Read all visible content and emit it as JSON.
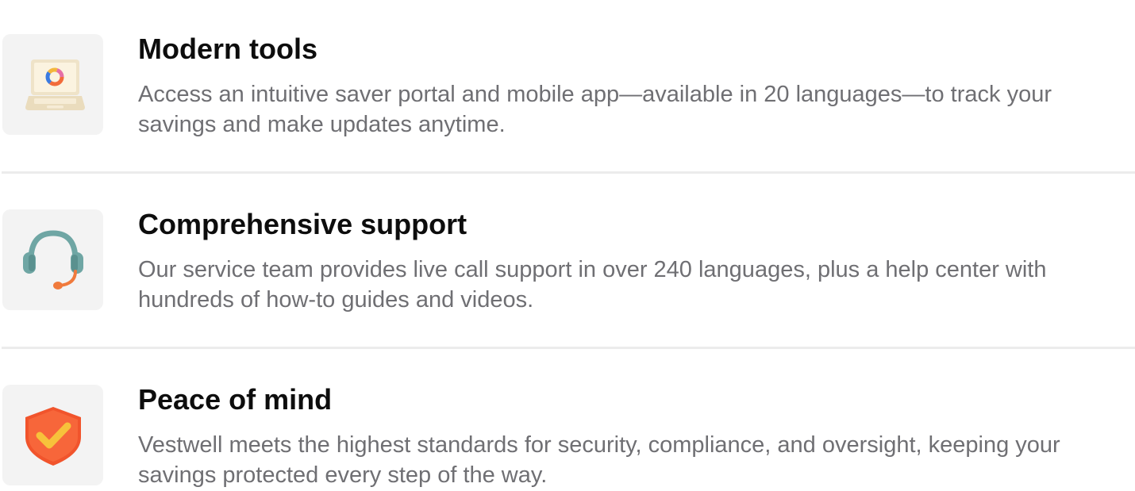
{
  "features": [
    {
      "icon": "laptop-icon",
      "title": "Modern tools",
      "description": "Access an intuitive saver portal and mobile app—available in 20 languages—to track your savings and make updates anytime."
    },
    {
      "icon": "headset-icon",
      "title": "Comprehensive support",
      "description": "Our service team provides live call support in over 240 languages, plus a help center with hundreds of how-to guides and videos."
    },
    {
      "icon": "shield-check-icon",
      "title": "Peace of mind",
      "description": "Vestwell meets the highest standards for security, compliance, and oversight, keeping your savings protected every step of the way."
    }
  ],
  "colors": {
    "title": "#0d0d0d",
    "description": "#6f6f73",
    "tile_background": "#f3f3f3",
    "divider": "#ececec",
    "headset": "#6fa6a4",
    "microphone": "#f07a3c",
    "shield": "#f1542c",
    "check": "#f7c23b"
  }
}
